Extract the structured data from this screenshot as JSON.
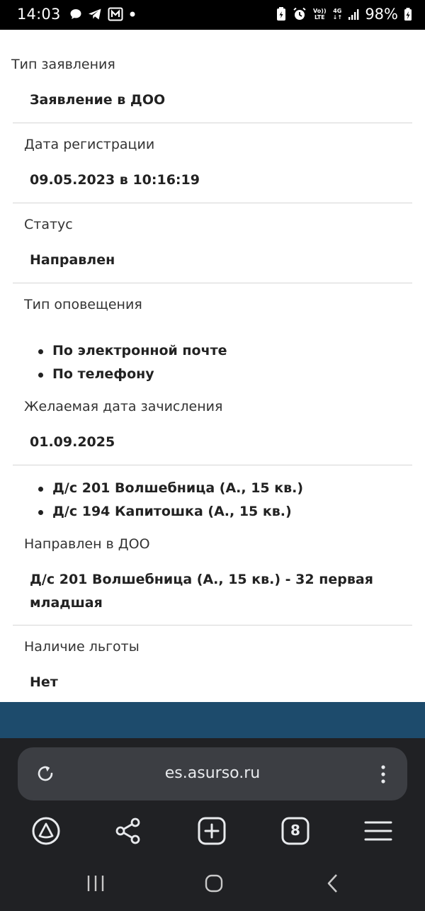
{
  "status_bar": {
    "time": "14:03",
    "battery": "98%",
    "volte_label": "Vo))\nLTE",
    "network": "4G"
  },
  "application": {
    "type_label": "Тип заявления",
    "type_value": "Заявление в ДОО",
    "reg_date_label": "Дата регистрации",
    "reg_date_value": "09.05.2023 в 10:16:19",
    "status_label": "Статус",
    "status_value": "Направлен",
    "notify_label": "Тип оповещения",
    "notify_items": [
      "По электронной почте",
      "По телефону"
    ],
    "desired_date_label": "Желаемая дата зачисления",
    "desired_date_value": "01.09.2025",
    "kindergartens": [
      "Д/с 201 Волшебница (А., 15 кв.)",
      "Д/с 194 Капитошка (А., 15 кв.)"
    ],
    "sent_to_label": "Направлен в ДОО",
    "sent_to_line1": "Д/с 201 Волшебница (А., 15 кв.) - 32 первая",
    "sent_to_line2": "младшая",
    "benefit_label": "Наличие льготы",
    "benefit_value": "Нет"
  },
  "browser": {
    "url": "es.asurso.ru",
    "tabs_count": "8"
  },
  "colors": {
    "footer_band": "#1d4b6c",
    "browser_bg": "#202124",
    "url_bar_bg": "#3c3e43"
  }
}
